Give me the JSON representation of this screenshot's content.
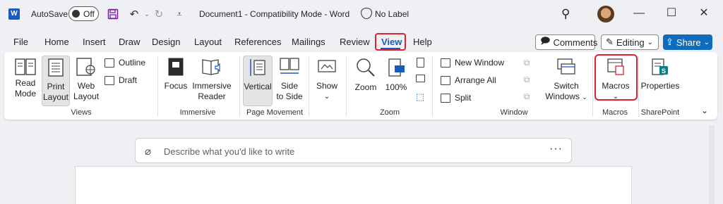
{
  "title_bar": {
    "autosave_label": "AutoSave",
    "autosave_state": "Off",
    "document_title": "Document1  -  Compatibility Mode  -  Word",
    "sensitivity_label": "No Label"
  },
  "menu": {
    "tabs": [
      "File",
      "Home",
      "Insert",
      "Draw",
      "Design",
      "Layout",
      "References",
      "Mailings",
      "Review",
      "View",
      "Help"
    ],
    "active_tab": "View",
    "comments_label": "Comments",
    "editing_label": "Editing",
    "share_label": "Share"
  },
  "ribbon": {
    "views": {
      "group": "Views",
      "read_mode": [
        "Read",
        "Mode"
      ],
      "print_layout": [
        "Print",
        "Layout"
      ],
      "web_layout": [
        "Web",
        "Layout"
      ],
      "outline": "Outline",
      "draft": "Draft"
    },
    "immersive": {
      "group": "Immersive",
      "focus": "Focus",
      "immersive_reader": [
        "Immersive",
        "Reader"
      ]
    },
    "page_movement": {
      "group": "Page Movement",
      "vertical": "Vertical",
      "side_to_side": [
        "Side",
        "to Side"
      ]
    },
    "show": {
      "label": "Show"
    },
    "zoom": {
      "group": "Zoom",
      "zoom": "Zoom",
      "hundred": "100%"
    },
    "window": {
      "group": "Window",
      "new_window": "New Window",
      "arrange_all": "Arrange All",
      "split": "Split",
      "switch_windows": [
        "Switch",
        "Windows"
      ]
    },
    "macros": {
      "group": "Macros",
      "label": "Macros"
    },
    "sharepoint": {
      "group": "SharePoint",
      "properties": "Properties"
    }
  },
  "copilot": {
    "placeholder": "Describe what you'd like to write",
    "more": "···"
  },
  "colors": {
    "accent": "#185abd",
    "share": "#0f6cbd",
    "highlight": "#d9232e",
    "background": "#eef0f4"
  }
}
